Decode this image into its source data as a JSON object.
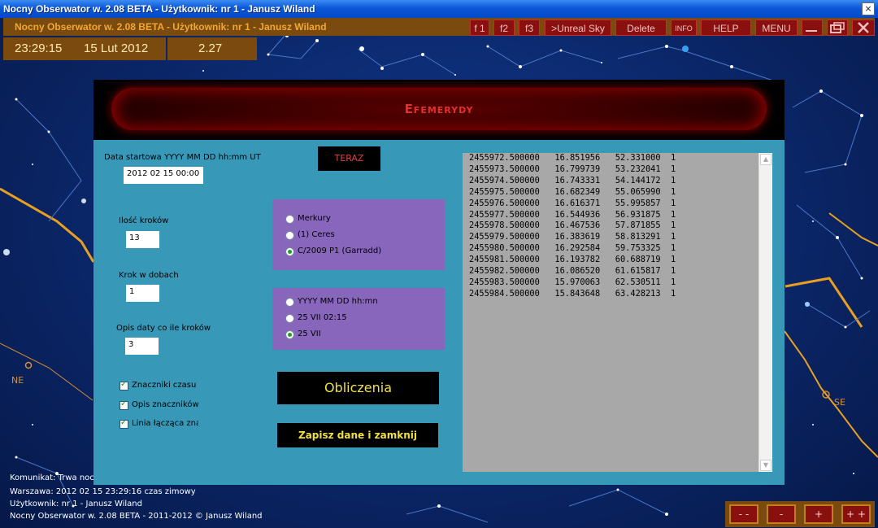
{
  "window": {
    "title": "Nocny Obserwator w. 2.08 BETA -  Użytkownik:  nr 1 - Janusz Wiland",
    "close_label": "×"
  },
  "appbar": {
    "title": "Nocny Obserwator w. 2.08 BETA -  Użytkownik:  nr 1 - Janusz Wiland",
    "buttons": [
      "f 1",
      "f2",
      "f3",
      ">Unreal Sky",
      "Delete",
      "INFO",
      "HELP",
      "MENU"
    ],
    "minimize_icon": "minimize-icon",
    "restore_icon": "restore-icon",
    "close_icon": "close-icon"
  },
  "clock": {
    "time": "23:29:15",
    "date": "15 Lut 2012",
    "magnitude": "2.27"
  },
  "dialog": {
    "title": "Efemerydy",
    "now_button": "TERAZ",
    "start_date_label": "Data startowa YYYY MM DD  hh:mm UT",
    "start_date_value": "2012 02 15  00:00",
    "steps_label": "Ilość kroków",
    "steps_value": "13",
    "step_days_label": "Krok w dobach",
    "step_days_value": "1",
    "date_desc_label": "Opis daty co ile kroków",
    "date_desc_value": "3",
    "objects": [
      {
        "label": "Merkury",
        "selected": false
      },
      {
        "label": "(1) Ceres",
        "selected": false
      },
      {
        "label": "C/2009 P1 (Garradd)",
        "selected": true
      }
    ],
    "date_formats": [
      {
        "label": "YYYY MM  DD  hh:mn",
        "selected": false
      },
      {
        "label": "25 VII  02:15",
        "selected": false
      },
      {
        "label": "25 VII",
        "selected": true
      }
    ],
    "checkboxes": [
      {
        "label": "Znaczniki czasu",
        "checked": true
      },
      {
        "label": "Opis znaczników",
        "checked": true
      },
      {
        "label": "Linia łącząca znaczniki",
        "checked": true
      }
    ],
    "calc_button": "Obliczenia",
    "save_button": "Zapisz dane i zamknij",
    "results": [
      [
        "2455972.500000",
        "16.851956",
        "52.331000",
        "1"
      ],
      [
        "2455973.500000",
        "16.799739",
        "53.232041",
        "1"
      ],
      [
        "2455974.500000",
        "16.743331",
        "54.144172",
        "1"
      ],
      [
        "2455975.500000",
        "16.682349",
        "55.065990",
        "1"
      ],
      [
        "2455976.500000",
        "16.616371",
        "55.995857",
        "1"
      ],
      [
        "2455977.500000",
        "16.544936",
        "56.931875",
        "1"
      ],
      [
        "2455978.500000",
        "16.467536",
        "57.871855",
        "1"
      ],
      [
        "2455979.500000",
        "16.383619",
        "58.813291",
        "1"
      ],
      [
        "2455980.500000",
        "16.292584",
        "59.753325",
        "1"
      ],
      [
        "2455981.500000",
        "16.193782",
        "60.688719",
        "1"
      ],
      [
        "2455982.500000",
        "16.086520",
        "61.615817",
        "1"
      ],
      [
        "2455983.500000",
        "15.970063",
        "62.530511",
        "1"
      ],
      [
        "2455984.500000",
        "15.843648",
        "63.428213",
        "1"
      ]
    ]
  },
  "status": {
    "message": "Komunikat: Trwa noc",
    "location": "Warszawa:  2012 02 15  23:29:16 czas zimowy",
    "user": "Użytkownik:  nr 1 - Janusz Wiland",
    "footer": "Nocny Obserwator w. 2.08 BETA - 2011-2012 © Janusz Wiland"
  },
  "compass": {
    "ne": "NE",
    "se": "SE"
  },
  "zoom": {
    "buttons": [
      "- -",
      "-",
      "+",
      "+ +"
    ]
  },
  "colors": {
    "accent": "#7a4a0e",
    "button_red": "#8a1010",
    "dialog_bg": "#3798b8",
    "radio_box": "#8866bb"
  }
}
